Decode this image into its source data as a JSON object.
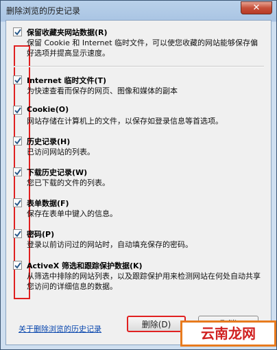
{
  "window": {
    "title": "删除浏览的历史记录",
    "close_label": "✕"
  },
  "items": [
    {
      "title": "保留收藏夹网站数据(R)",
      "desc": "保留 Cookie 和 Internet 临时文件，可以使您收藏的网站能够保存偏好选项并提高显示速度。",
      "checked": true
    },
    {
      "title": "Internet 临时文件(T)",
      "desc": "为快速查看而保存的网页、图像和媒体的副本",
      "checked": true
    },
    {
      "title": "Cookie(O)",
      "desc": "网站存储在计算机上的文件，以保存如登录信息等首选项。",
      "checked": true
    },
    {
      "title": "历史记录(H)",
      "desc": "已访问网站的列表。",
      "checked": true
    },
    {
      "title": "下载历史记录(W)",
      "desc": "您已下载的文件的列表。",
      "checked": true
    },
    {
      "title": "表单数据(F)",
      "desc": "保存在表单中键入的信息。",
      "checked": true
    },
    {
      "title": "密码(P)",
      "desc": "登录以前访问过的网站时，自动填充保存的密码。",
      "checked": true
    },
    {
      "title": "ActiveX 筛选和跟踪保护数据(K)",
      "desc": "从筛选中排除的网站列表，以及跟踪保护用来检测网站在何处自动共享您访问的详细信息的数据。",
      "checked": true
    }
  ],
  "footer": {
    "link_label": "关于删除浏览的历史记录",
    "delete_label": "删除(D)",
    "cancel_label": "取消"
  },
  "watermark": {
    "text": "云南龙网"
  },
  "colors": {
    "highlight": "#e02020",
    "link": "#0645ad"
  }
}
